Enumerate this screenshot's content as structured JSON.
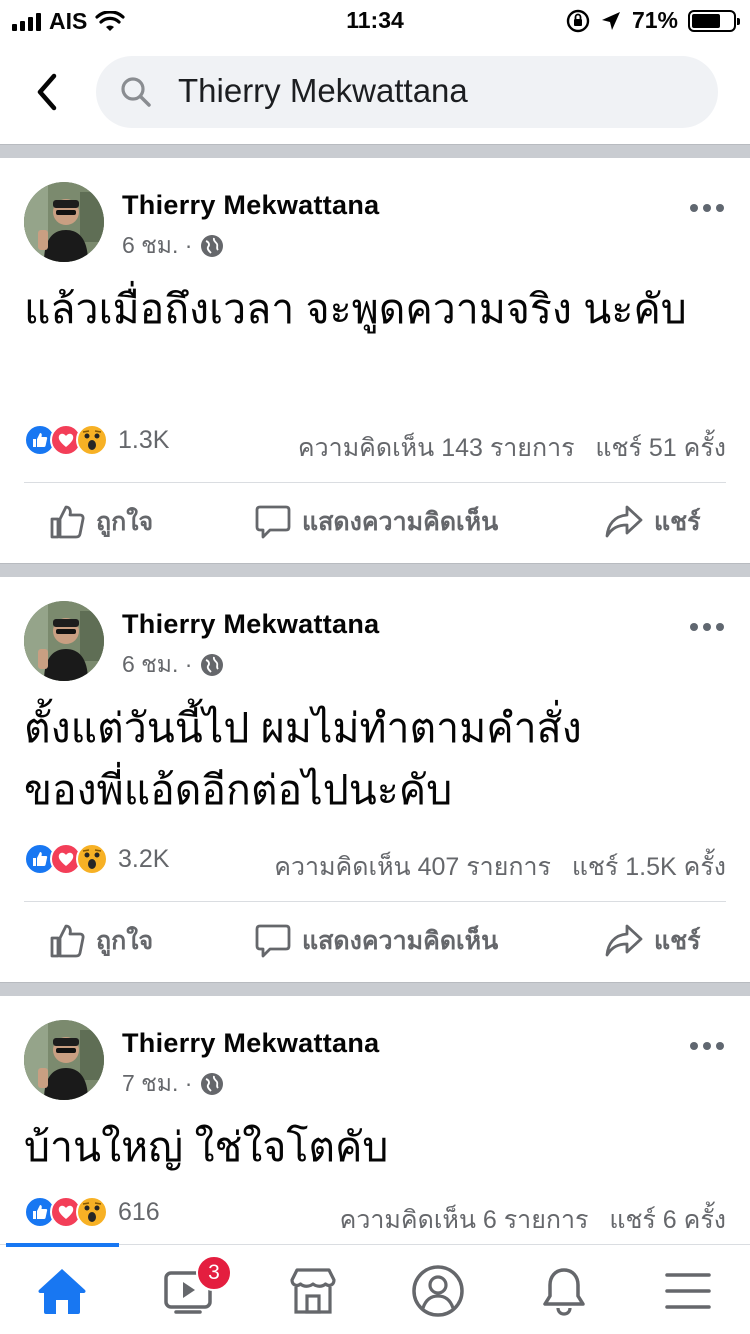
{
  "status_bar": {
    "carrier": "AIS",
    "time": "11:34",
    "battery_percent": "71%",
    "battery_level": 0.71
  },
  "search": {
    "query": "Thierry Mekwattana"
  },
  "posts": [
    {
      "author": "Thierry Mekwattana",
      "time": "6 ชม. ·",
      "text": "แล้วเมื่อถึงเวลา จะพูดความจริง นะคับ",
      "reaction_count": "1.3K",
      "comments_text": "ความคิดเห็น 143 รายการ",
      "shares_text": "แชร์ 51 ครั้ง"
    },
    {
      "author": "Thierry Mekwattana",
      "time": "6 ชม. ·",
      "text": "ตั้งแต่วันนี้ไป ผมไม่ทำตามคำสั่งของพี่แอ้ดอีกต่อไปนะคับ",
      "reaction_count": "3.2K",
      "comments_text": "ความคิดเห็น 407 รายการ",
      "shares_text": "แชร์ 1.5K ครั้ง"
    },
    {
      "author": "Thierry Mekwattana",
      "time": "7 ชม. ·",
      "text": "บ้านใหญ่ ใช่ใจโตคับ",
      "reaction_count": "616",
      "comments_text": "ความคิดเห็น 6 รายการ",
      "shares_text": "แชร์ 6 ครั้ง"
    }
  ],
  "actions": {
    "like": "ถูกใจ",
    "comment": "แสดงความคิดเห็น",
    "share": "แชร์"
  },
  "tabbar": {
    "watch_badge": "3",
    "tabs": [
      "home-icon",
      "watch-icon",
      "marketplace-icon",
      "profile-icon",
      "notifications-icon",
      "menu-icon"
    ]
  },
  "colors": {
    "brand_blue": "#1877f2",
    "secondary_text": "#65676b",
    "badge_red": "#e41e3f",
    "like_blue": "#1877f2",
    "love_red": "#f33e58",
    "wow_yellow": "#f7b125"
  }
}
